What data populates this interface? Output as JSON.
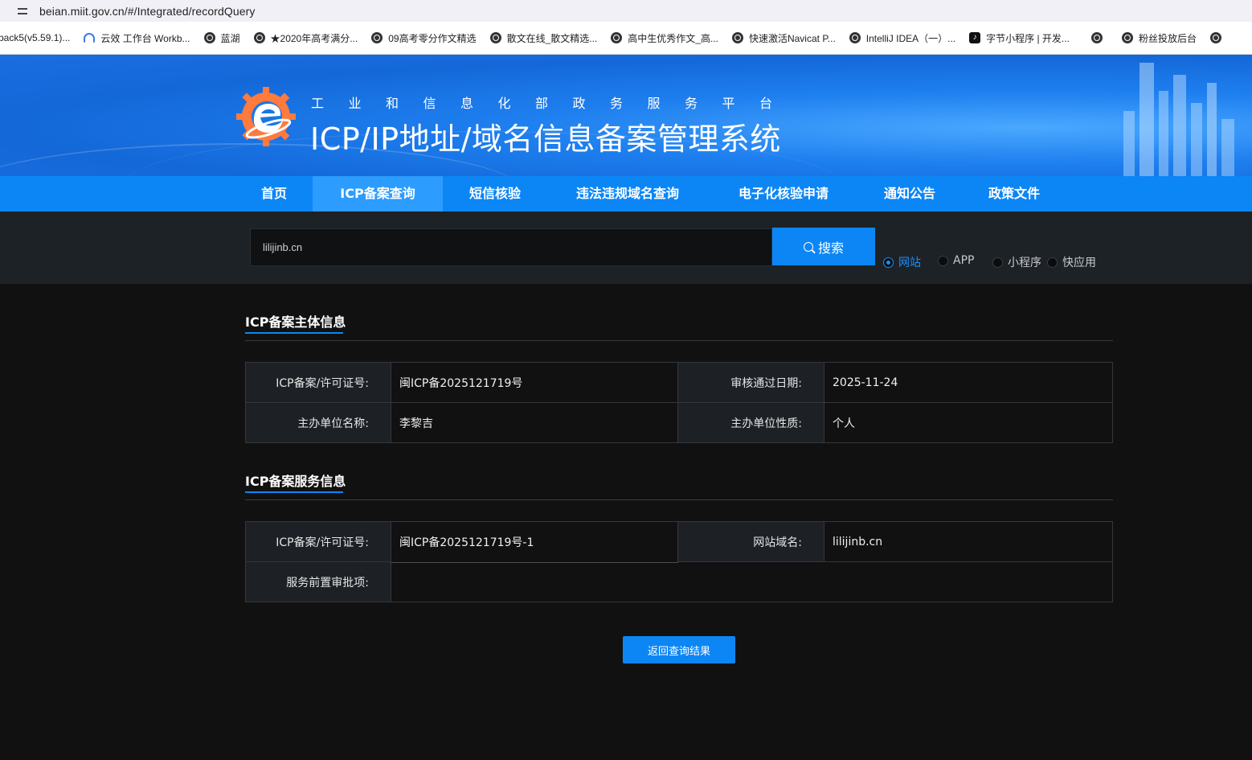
{
  "browser": {
    "url": "beian.miit.gov.cn/#/Integrated/recordQuery",
    "bookmarks": [
      {
        "label": "back5(v5.59.1)...",
        "icon": "none"
      },
      {
        "label": "云效 工作台 Workb...",
        "icon": "cloud-icon"
      },
      {
        "label": "蓝湖",
        "icon": "globe-icon"
      },
      {
        "label": "★2020年高考满分...",
        "icon": "globe-icon"
      },
      {
        "label": "09高考零分作文精选",
        "icon": "globe-icon"
      },
      {
        "label": "散文在线_散文精选...",
        "icon": "globe-icon"
      },
      {
        "label": "高中生优秀作文_高...",
        "icon": "globe-icon"
      },
      {
        "label": "快速激活Navicat P...",
        "icon": "globe-icon"
      },
      {
        "label": "IntelliJ IDEA（一）...",
        "icon": "globe-icon"
      },
      {
        "label": "字节小程序 | 开发...",
        "icon": "tiktok-icon"
      },
      {
        "label": "",
        "icon": "globe-icon"
      },
      {
        "label": "粉丝投放后台",
        "icon": "globe-icon"
      }
    ]
  },
  "header": {
    "subtitle": "工业和信息化部政务服务平台",
    "title": "ICP/IP地址/域名信息备案管理系统"
  },
  "nav": {
    "items": [
      "首页",
      "ICP备案查询",
      "短信核验",
      "违法违规域名查询",
      "电子化核验申请",
      "通知公告",
      "政策文件"
    ],
    "active": "ICP备案查询"
  },
  "search": {
    "value": "lilijinb.cn",
    "button_label": "搜索",
    "options": [
      "网站",
      "APP",
      "小程序",
      "快应用"
    ],
    "selected": "网站"
  },
  "subject_info": {
    "title": "ICP备案主体信息",
    "rows": [
      {
        "label1": "ICP备案/许可证号:",
        "value1": "闽ICP备2025121719号",
        "label2": "审核通过日期:",
        "value2": "2025-11-24"
      },
      {
        "label1": "主办单位名称:",
        "value1": "李黎吉",
        "label2": "主办单位性质:",
        "value2": "个人"
      }
    ]
  },
  "service_info": {
    "title": "ICP备案服务信息",
    "license_label": "ICP备案/许可证号:",
    "license_value": "闽ICP备2025121719号-1",
    "domain_label": "网站域名:",
    "domain_value": "lilijinb.cn",
    "approval_label": "服务前置审批项:",
    "approval_value": ""
  },
  "back_button": "返回查询结果",
  "colors": {
    "primary": "#0c86f5",
    "background": "#111112",
    "label_bg": "#1d2126"
  }
}
